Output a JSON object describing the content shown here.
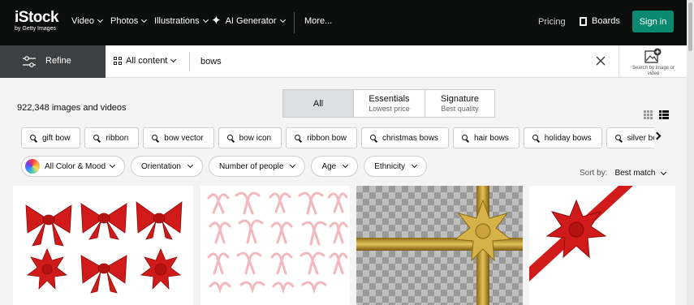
{
  "brand": {
    "logo": "iStock",
    "byline": "by Getty Images"
  },
  "nav": {
    "items": [
      "Video",
      "Photos",
      "Illustrations",
      "AI Generator"
    ],
    "more": "More...",
    "pricing": "Pricing",
    "boards": "Boards",
    "sign_in": "Sign in"
  },
  "search": {
    "refine_label": "Refine",
    "content_type": "All content",
    "query": "bows",
    "search_by_image": "Search by image or video"
  },
  "results": {
    "count_text": "922,348 images and videos"
  },
  "tabs": [
    {
      "label": "All",
      "sub": ""
    },
    {
      "label": "Essentials",
      "sub": "Lowest price"
    },
    {
      "label": "Signature",
      "sub": "Best quality"
    }
  ],
  "related_searches": [
    "gift bow",
    "ribbon",
    "bow vector",
    "bow icon",
    "ribbon bow",
    "christmas bows",
    "hair bows",
    "holiday bows",
    "silver bow"
  ],
  "filters": {
    "color": "All Color & Mood",
    "orientation": "Orientation",
    "people": "Number of people",
    "age": "Age",
    "ethnicity": "Ethnicity"
  },
  "sort": {
    "label": "Sort by:",
    "value": "Best match"
  },
  "colors": {
    "nav_bg": "#0c0d0d",
    "accent": "#0a8a6f",
    "refine_bg": "#3d3f40",
    "panel_bg": "#f4f4f4"
  }
}
